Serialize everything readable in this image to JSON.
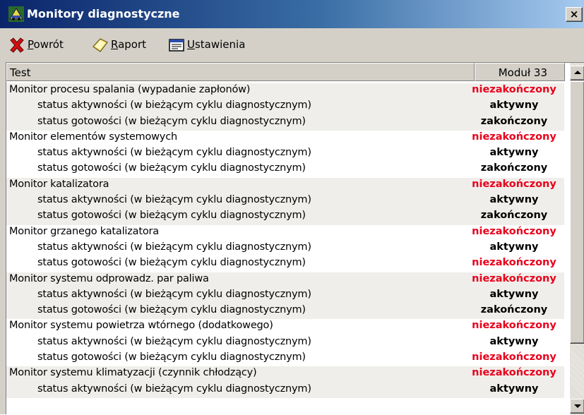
{
  "window": {
    "title": "Monitory diagnostyczne",
    "close_label": "×"
  },
  "toolbar": {
    "back": {
      "accel": "P",
      "rest": "owrót"
    },
    "report": {
      "accel": "R",
      "rest": "aport"
    },
    "settings": {
      "accel": "U",
      "rest": "stawienia"
    }
  },
  "table": {
    "columns": [
      "Test",
      "Moduł 33"
    ],
    "rows": [
      {
        "name": "Monitor procesu spalania (wypadanie zapłonów)",
        "value": "niezakończony",
        "level": "main",
        "status": "red"
      },
      {
        "name": "status aktywności (w bieżącym cyklu diagnostycznym)",
        "value": "aktywny",
        "level": "sub",
        "status": "black"
      },
      {
        "name": "status gotowości (w bieżącym cyklu diagnostycznym)",
        "value": "zakończony",
        "level": "sub",
        "status": "black"
      },
      {
        "name": "Monitor elementów systemowych",
        "value": "niezakończony",
        "level": "main",
        "status": "red"
      },
      {
        "name": "status aktywności (w bieżącym cyklu diagnostycznym)",
        "value": "aktywny",
        "level": "sub",
        "status": "black"
      },
      {
        "name": "status gotowości (w bieżącym cyklu diagnostycznym)",
        "value": "zakończony",
        "level": "sub",
        "status": "black"
      },
      {
        "name": "Monitor katalizatora",
        "value": "niezakończony",
        "level": "main",
        "status": "red"
      },
      {
        "name": "status aktywności (w bieżącym cyklu diagnostycznym)",
        "value": "aktywny",
        "level": "sub",
        "status": "black"
      },
      {
        "name": "status gotowości (w bieżącym cyklu diagnostycznym)",
        "value": "zakończony",
        "level": "sub",
        "status": "black"
      },
      {
        "name": "Monitor grzanego katalizatora",
        "value": "niezakończony",
        "level": "main",
        "status": "red"
      },
      {
        "name": "status aktywności (w bieżącym cyklu diagnostycznym)",
        "value": "aktywny",
        "level": "sub",
        "status": "black"
      },
      {
        "name": "status gotowości (w bieżącym cyklu diagnostycznym)",
        "value": "niezakończony",
        "level": "sub",
        "status": "red"
      },
      {
        "name": "Monitor systemu odprowadz. par paliwa",
        "value": "niezakończony",
        "level": "main",
        "status": "red"
      },
      {
        "name": "status aktywności (w bieżącym cyklu diagnostycznym)",
        "value": "aktywny",
        "level": "sub",
        "status": "black"
      },
      {
        "name": "status gotowości (w bieżącym cyklu diagnostycznym)",
        "value": "zakończony",
        "level": "sub",
        "status": "black"
      },
      {
        "name": "Monitor systemu powietrza wtórnego (dodatkowego)",
        "value": "niezakończony",
        "level": "main",
        "status": "red"
      },
      {
        "name": "status aktywności (w bieżącym cyklu diagnostycznym)",
        "value": "aktywny",
        "level": "sub",
        "status": "black"
      },
      {
        "name": "status gotowości (w bieżącym cyklu diagnostycznym)",
        "value": "niezakończony",
        "level": "sub",
        "status": "red"
      },
      {
        "name": "Monitor systemu klimatyzacji (czynnik chłodzący)",
        "value": "niezakończony",
        "level": "main",
        "status": "red"
      },
      {
        "name": "status aktywności (w bieżącym cyklu diagnostycznym)",
        "value": "aktywny",
        "level": "sub",
        "status": "black"
      }
    ]
  },
  "colors": {
    "title_gradient_start": "#0a246a",
    "status_red": "#e8001c",
    "status_black": "#000000",
    "face": "#d4d0c8"
  },
  "icons": {
    "title": "app-car-icon",
    "back": "red-x-icon",
    "report": "yellow-document-icon",
    "settings": "settings-window-icon"
  }
}
